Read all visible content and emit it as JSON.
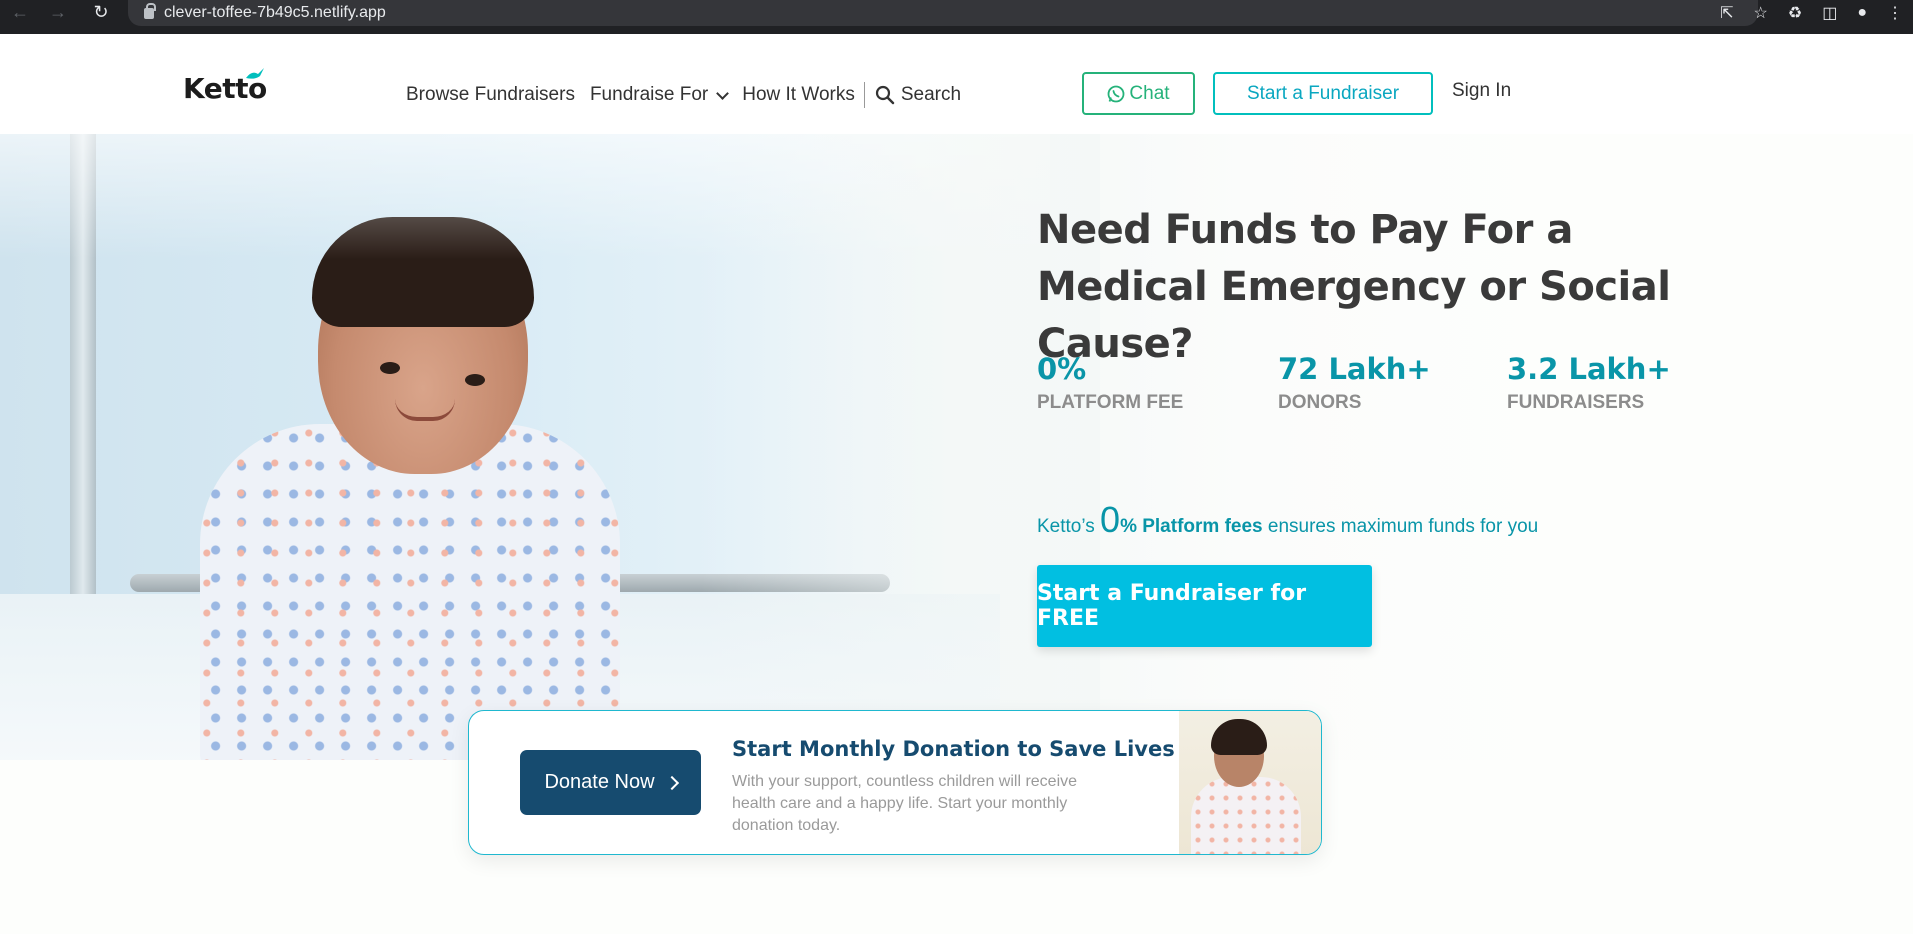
{
  "browser": {
    "url": "clever-toffee-7b49c5.netlify.app",
    "icons": [
      "back-icon",
      "forward-icon",
      "reload-icon",
      "lock-icon",
      "share-icon",
      "star-icon",
      "extensions-icon",
      "sidepanel-icon",
      "profile-icon",
      "menu-icon"
    ]
  },
  "header": {
    "logo": "Ketto",
    "nav": {
      "browse": "Browse Fundraisers",
      "fundraise_for": "Fundraise For",
      "how_it_works": "How It Works",
      "search": "Search"
    },
    "chat_label": "Chat",
    "start_label": "Start a Fundraiser",
    "signin_label": "Sign In"
  },
  "hero": {
    "title": "Need Funds to Pay For a Medical Emergency or Social Cause?",
    "stats": [
      {
        "value": "0%",
        "label": "PLATFORM FEE"
      },
      {
        "value": "72 Lakh+",
        "label": "DONORS"
      },
      {
        "value": "3.2 Lakh+",
        "label": "FUNDRAISERS"
      }
    ],
    "fee_prefix": "Ketto’s",
    "fee_big": "0",
    "fee_bold": "% Platform fees",
    "fee_suffix": "ensures maximum funds for you",
    "cta": "Start a Fundraiser for FREE"
  },
  "donation_card": {
    "button": "Donate Now",
    "title": "Start Monthly Donation to Save Lives",
    "description": "With your support, countless children will receive health care and a happy life. Start your monthly donation today."
  },
  "colors": {
    "accent": "#01bfe1",
    "teal_text": "#0995a8",
    "navy": "#164b6f",
    "chat_green": "#25b27a"
  }
}
